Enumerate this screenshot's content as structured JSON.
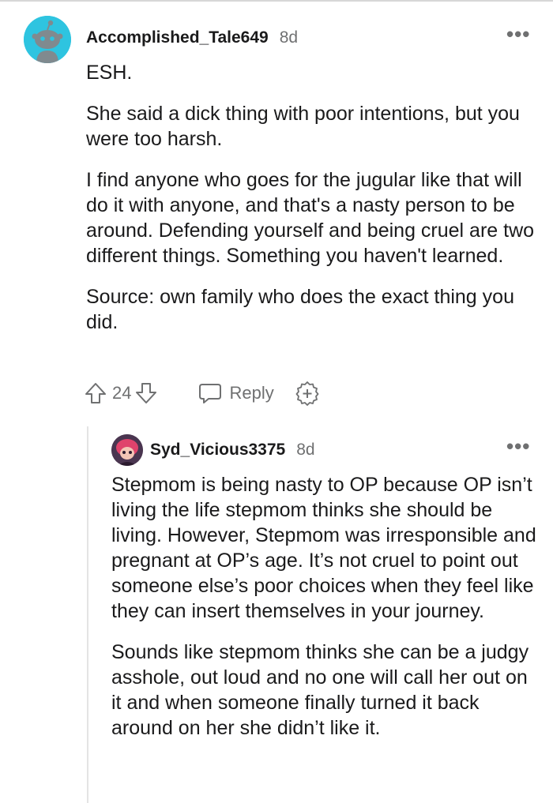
{
  "parent_comment": {
    "username": "Accomplished_Tale649",
    "age": "8d",
    "more_label": "•••",
    "avatar_icon": "snoo-avatar-icon",
    "avatar_color": "#2ec4e0",
    "paragraphs": [
      "ESH.",
      "She said a dick thing with poor intentions, but you were too harsh.",
      "I find anyone who goes for the jugular like that will do it with anyone, and that's a nasty person to be around. Defending yourself and being cruel are two different things. Something you haven't learned.",
      "Source: own family who does the exact thing you did."
    ],
    "actions": {
      "upvote_icon": "upvote-arrow-icon",
      "vote_count": "24",
      "downvote_icon": "downvote-arrow-icon",
      "reply_icon": "reply-bubble-icon",
      "reply_label": "Reply",
      "award_icon": "award-plus-icon"
    }
  },
  "reply_comment": {
    "username": "Syd_Vicious3375",
    "age": "8d",
    "more_label": "•••",
    "avatar_icon": "user-avatar-icon",
    "paragraphs": [
      "Stepmom is being nasty to OP because OP isn’t living the life stepmom thinks she should be living. However, Stepmom was irresponsible and pregnant at OP’s age. It’s not cruel to point out someone else’s poor choices when they feel like they can insert themselves in your journey.",
      "Sounds like stepmom thinks she can be a judgy asshole, out loud and no one will call her out on it and when someone finally turned it back around on her she didn’t like it."
    ]
  },
  "colors": {
    "text": "#1a1a1b",
    "meta": "#6f7071",
    "thread_line": "#e4e4e4"
  }
}
